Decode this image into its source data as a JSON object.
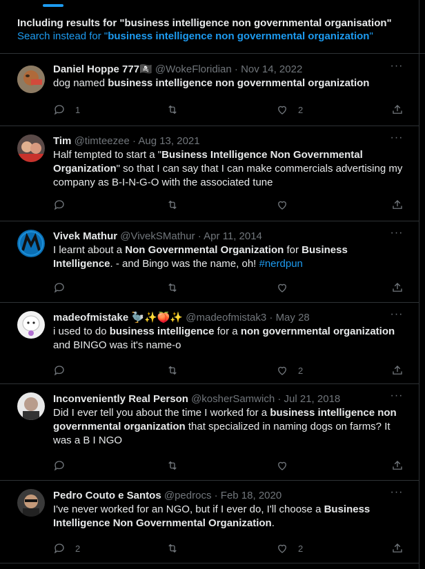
{
  "spelling": {
    "including_prefix": "Including results for \"business intelligence non governmental organisation\"",
    "search_instead_prefix": "Search instead for \"",
    "search_instead_query": "business intelligence non governmental organization",
    "search_instead_suffix": "\""
  },
  "more_label": "···",
  "tweets": [
    {
      "name": "Daniel Hoppe 777🏴‍☠️",
      "handle": "@WokeFloridian",
      "date": "Nov 14, 2022",
      "text": [
        "dog named ",
        "business intelligence non governmental organization"
      ],
      "replies": "1",
      "retweets": "",
      "likes": "2"
    },
    {
      "name": "Tim",
      "handle": "@timteezee",
      "date": "Aug 13, 2021",
      "text": [
        "Half tempted to start a \"",
        "Business Intelligence Non Governmental Organization",
        "\" so that I can say that I can make commercials advertising my company as B-I-N-G-O with the associated tune"
      ],
      "replies": "",
      "retweets": "",
      "likes": ""
    },
    {
      "name": "Vivek Mathur",
      "handle": "@VivekSMathur",
      "date": "Apr 11, 2014",
      "text": [
        "I learnt about a ",
        "Non Governmental Organization",
        " for ",
        "Business Intelligence",
        ". - and Bingo was the name, oh! "
      ],
      "hashtag": "#nerdpun",
      "replies": "",
      "retweets": "",
      "likes": ""
    },
    {
      "name": "madeofmistake 🦤✨🍑✨",
      "handle": "@madeofmistak3",
      "date": "May 28",
      "text": [
        "i used to do ",
        "business intelligence",
        " for a ",
        "non governmental organization",
        " and BINGO was it's name-o"
      ],
      "replies": "",
      "retweets": "",
      "likes": "2"
    },
    {
      "name": "Inconveniently Real Person",
      "handle": "@kosherSamwich",
      "date": "Jul 21, 2018",
      "text": [
        "Did I ever tell you about the time I worked for a ",
        "business intelligence non governmental organization",
        " that specialized in naming dogs on farms? It was a B I NGO"
      ],
      "replies": "",
      "retweets": "",
      "likes": ""
    },
    {
      "name": "Pedro Couto e Santos",
      "handle": "@pedrocs",
      "date": "Feb 18, 2020",
      "text": [
        "I've never worked for an NGO, but if I ever do, I'll choose a ",
        "Business Intelligence Non Governmental Organization",
        "."
      ],
      "replies": "2",
      "retweets": "",
      "likes": "2"
    }
  ],
  "colors": {
    "accent": "#1d9bf0",
    "muted": "#71767b",
    "border": "#2f3336",
    "background": "#000000"
  },
  "icons": [
    "reply-icon",
    "retweet-icon",
    "like-icon",
    "share-icon",
    "more-icon"
  ]
}
